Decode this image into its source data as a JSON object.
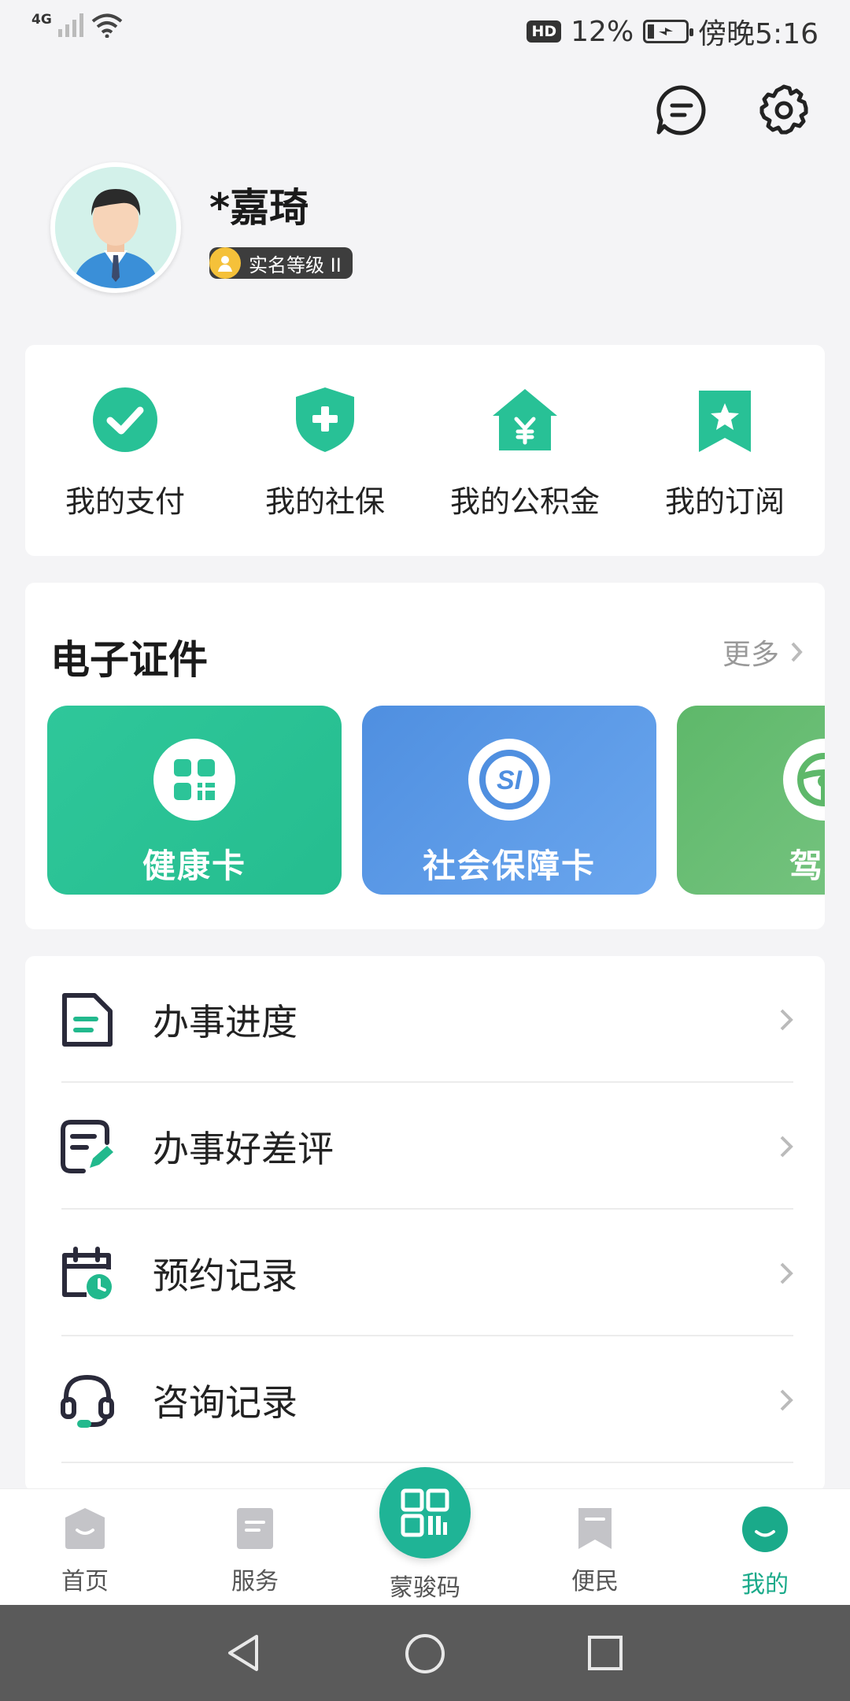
{
  "status_bar": {
    "network": "4G",
    "hd": "HD",
    "battery_percent": "12%",
    "time": "傍晚5:16"
  },
  "header": {
    "message_icon": "message-icon",
    "settings_icon": "gear-icon"
  },
  "profile": {
    "name": "*嘉琦",
    "level": "实名等级 II"
  },
  "quick_links": [
    {
      "label": "我的支付",
      "icon": "check-circle-icon"
    },
    {
      "label": "我的社保",
      "icon": "shield-plus-icon"
    },
    {
      "label": "我的公积金",
      "icon": "house-yen-icon"
    },
    {
      "label": "我的订阅",
      "icon": "bookmark-star-icon"
    }
  ],
  "certificates": {
    "title": "电子证件",
    "more": "更多",
    "items": [
      {
        "label": "健康卡",
        "icon": "qr-icon"
      },
      {
        "label": "社会保障卡",
        "icon": "social-security-icon"
      },
      {
        "label": "驾驶",
        "icon": "steering-wheel-icon"
      }
    ]
  },
  "records": [
    {
      "label": "办事进度",
      "icon": "folder-doc-icon"
    },
    {
      "label": "办事好差评",
      "icon": "note-edit-icon"
    },
    {
      "label": "预约记录",
      "icon": "calendar-clock-icon"
    },
    {
      "label": "咨询记录",
      "icon": "headset-icon"
    }
  ],
  "tabbar": {
    "tabs": [
      {
        "label": "首页",
        "icon": "home-icon"
      },
      {
        "label": "服务",
        "icon": "service-icon"
      },
      {
        "label": "蒙骏码",
        "icon": "qr-code-icon"
      },
      {
        "label": "便民",
        "icon": "bookmark-icon"
      },
      {
        "label": "我的",
        "icon": "profile-face-icon",
        "active": true
      }
    ]
  },
  "colors": {
    "accent": "#1fb496",
    "health_card": "#2fc79a",
    "social_card": "#5a9ae6",
    "driver_card": "#6cbf76"
  }
}
